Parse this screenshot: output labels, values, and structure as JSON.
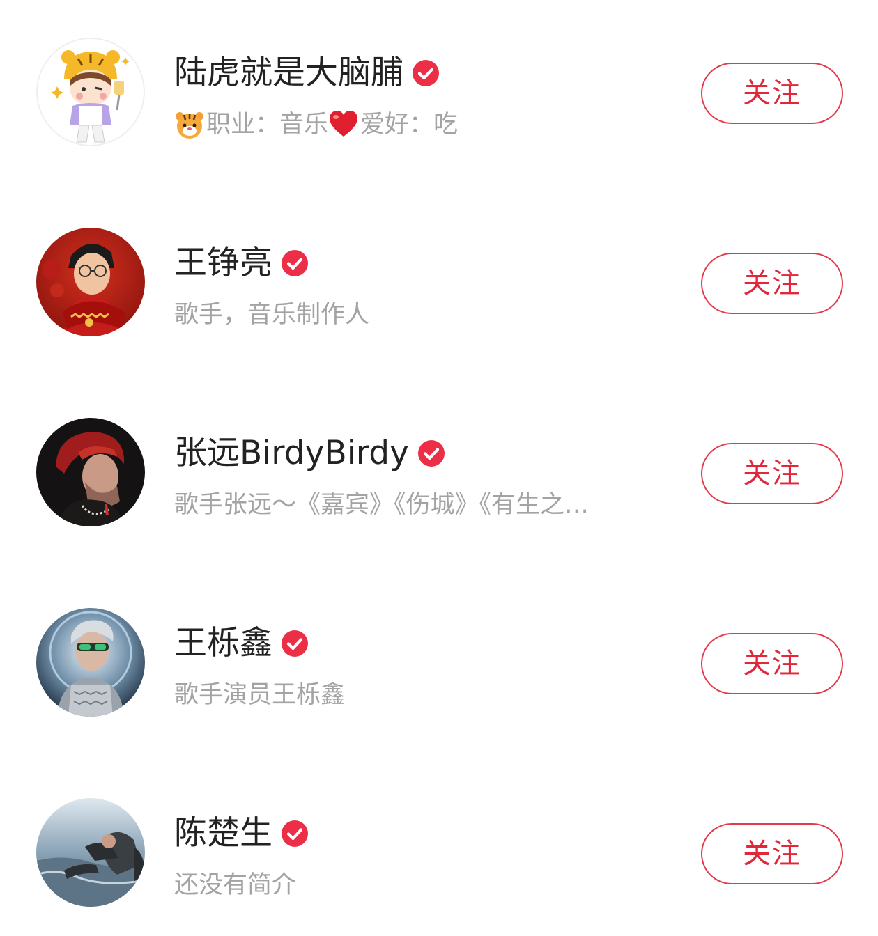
{
  "accent_color": "#e1273a",
  "verified_icon": "verified-check-icon",
  "follow_label": "关注",
  "users": [
    {
      "name": "陆虎就是大脑脯",
      "bio_segments": [
        {
          "type": "icon",
          "icon": "tiger-emoji-icon"
        },
        {
          "type": "text",
          "text": "职业：音乐 "
        },
        {
          "type": "icon",
          "icon": "red-heart-emoji-icon"
        },
        {
          "type": "text",
          "text": "爱好：吃"
        }
      ],
      "follow_label": "关注"
    },
    {
      "name": "王铮亮",
      "bio": "歌手，音乐制作人",
      "follow_label": "关注"
    },
    {
      "name": "张远BirdyBirdy",
      "bio": "歌手张远～《嘉宾》《伤城》《有生之…",
      "follow_label": "关注"
    },
    {
      "name": "王栎鑫",
      "bio": "歌手演员王栎鑫",
      "follow_label": "关注"
    },
    {
      "name": "陈楚生",
      "bio": "还没有简介",
      "follow_label": "关注"
    }
  ]
}
